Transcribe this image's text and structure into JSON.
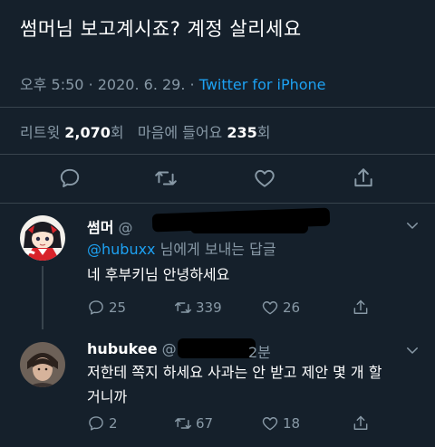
{
  "tweet": {
    "text": "썸머님 보고계시죠? 계정 살리세요",
    "time": "오후 5:50",
    "date": "2020. 6. 29.",
    "separator": "·",
    "source": "Twitter for iPhone",
    "retweets_label": "리트윗",
    "retweets_count": "2,070",
    "retweets_unit": "회",
    "likes_label": "마음에 들어요",
    "likes_count": "235",
    "likes_unit": "회"
  },
  "actions": {
    "reply_icon": "comment-icon",
    "retweet_icon": "retweet-icon",
    "like_icon": "heart-icon",
    "share_icon": "share-icon"
  },
  "replies": [
    {
      "name": "썸머",
      "handle": "@",
      "replying_mention": "@hubuxx",
      "replying_suffix": " 님에게 보내는 답글",
      "text_lines": [
        "네 후부키님 안녕하세요"
      ],
      "reply_count": "25",
      "retweet_count": "339",
      "like_count": "26"
    },
    {
      "name": "hubukee",
      "handle": "@",
      "time": "2분",
      "text_lines": [
        "저한테 쪽지 하세요 사과는 안 받고 제안 몇 개 할",
        "거니까"
      ],
      "reply_count": "2",
      "retweet_count": "67",
      "like_count": "18"
    }
  ],
  "colors": {
    "background": "#15202b",
    "secondary_text": "#8899a6",
    "accent": "#1da1f2",
    "divider": "#38444d"
  }
}
